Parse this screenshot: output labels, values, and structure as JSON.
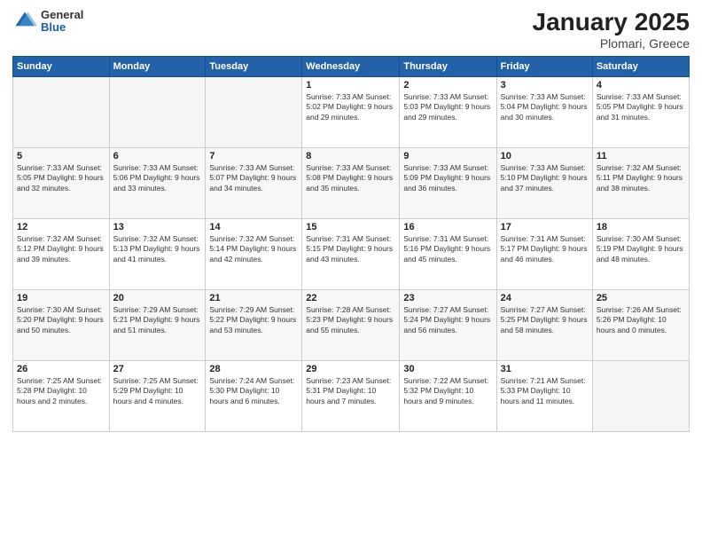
{
  "header": {
    "logo_general": "General",
    "logo_blue": "Blue",
    "title": "January 2025",
    "subtitle": "Plomari, Greece"
  },
  "days_of_week": [
    "Sunday",
    "Monday",
    "Tuesday",
    "Wednesday",
    "Thursday",
    "Friday",
    "Saturday"
  ],
  "weeks": [
    {
      "days": [
        {
          "num": "",
          "info": "",
          "empty": true
        },
        {
          "num": "",
          "info": "",
          "empty": true
        },
        {
          "num": "",
          "info": "",
          "empty": true
        },
        {
          "num": "1",
          "info": "Sunrise: 7:33 AM\nSunset: 5:02 PM\nDaylight: 9 hours\nand 29 minutes.",
          "empty": false
        },
        {
          "num": "2",
          "info": "Sunrise: 7:33 AM\nSunset: 5:03 PM\nDaylight: 9 hours\nand 29 minutes.",
          "empty": false
        },
        {
          "num": "3",
          "info": "Sunrise: 7:33 AM\nSunset: 5:04 PM\nDaylight: 9 hours\nand 30 minutes.",
          "empty": false
        },
        {
          "num": "4",
          "info": "Sunrise: 7:33 AM\nSunset: 5:05 PM\nDaylight: 9 hours\nand 31 minutes.",
          "empty": false
        }
      ]
    },
    {
      "days": [
        {
          "num": "5",
          "info": "Sunrise: 7:33 AM\nSunset: 5:05 PM\nDaylight: 9 hours\nand 32 minutes.",
          "empty": false
        },
        {
          "num": "6",
          "info": "Sunrise: 7:33 AM\nSunset: 5:06 PM\nDaylight: 9 hours\nand 33 minutes.",
          "empty": false
        },
        {
          "num": "7",
          "info": "Sunrise: 7:33 AM\nSunset: 5:07 PM\nDaylight: 9 hours\nand 34 minutes.",
          "empty": false
        },
        {
          "num": "8",
          "info": "Sunrise: 7:33 AM\nSunset: 5:08 PM\nDaylight: 9 hours\nand 35 minutes.",
          "empty": false
        },
        {
          "num": "9",
          "info": "Sunrise: 7:33 AM\nSunset: 5:09 PM\nDaylight: 9 hours\nand 36 minutes.",
          "empty": false
        },
        {
          "num": "10",
          "info": "Sunrise: 7:33 AM\nSunset: 5:10 PM\nDaylight: 9 hours\nand 37 minutes.",
          "empty": false
        },
        {
          "num": "11",
          "info": "Sunrise: 7:32 AM\nSunset: 5:11 PM\nDaylight: 9 hours\nand 38 minutes.",
          "empty": false
        }
      ]
    },
    {
      "days": [
        {
          "num": "12",
          "info": "Sunrise: 7:32 AM\nSunset: 5:12 PM\nDaylight: 9 hours\nand 39 minutes.",
          "empty": false
        },
        {
          "num": "13",
          "info": "Sunrise: 7:32 AM\nSunset: 5:13 PM\nDaylight: 9 hours\nand 41 minutes.",
          "empty": false
        },
        {
          "num": "14",
          "info": "Sunrise: 7:32 AM\nSunset: 5:14 PM\nDaylight: 9 hours\nand 42 minutes.",
          "empty": false
        },
        {
          "num": "15",
          "info": "Sunrise: 7:31 AM\nSunset: 5:15 PM\nDaylight: 9 hours\nand 43 minutes.",
          "empty": false
        },
        {
          "num": "16",
          "info": "Sunrise: 7:31 AM\nSunset: 5:16 PM\nDaylight: 9 hours\nand 45 minutes.",
          "empty": false
        },
        {
          "num": "17",
          "info": "Sunrise: 7:31 AM\nSunset: 5:17 PM\nDaylight: 9 hours\nand 46 minutes.",
          "empty": false
        },
        {
          "num": "18",
          "info": "Sunrise: 7:30 AM\nSunset: 5:19 PM\nDaylight: 9 hours\nand 48 minutes.",
          "empty": false
        }
      ]
    },
    {
      "days": [
        {
          "num": "19",
          "info": "Sunrise: 7:30 AM\nSunset: 5:20 PM\nDaylight: 9 hours\nand 50 minutes.",
          "empty": false
        },
        {
          "num": "20",
          "info": "Sunrise: 7:29 AM\nSunset: 5:21 PM\nDaylight: 9 hours\nand 51 minutes.",
          "empty": false
        },
        {
          "num": "21",
          "info": "Sunrise: 7:29 AM\nSunset: 5:22 PM\nDaylight: 9 hours\nand 53 minutes.",
          "empty": false
        },
        {
          "num": "22",
          "info": "Sunrise: 7:28 AM\nSunset: 5:23 PM\nDaylight: 9 hours\nand 55 minutes.",
          "empty": false
        },
        {
          "num": "23",
          "info": "Sunrise: 7:27 AM\nSunset: 5:24 PM\nDaylight: 9 hours\nand 56 minutes.",
          "empty": false
        },
        {
          "num": "24",
          "info": "Sunrise: 7:27 AM\nSunset: 5:25 PM\nDaylight: 9 hours\nand 58 minutes.",
          "empty": false
        },
        {
          "num": "25",
          "info": "Sunrise: 7:26 AM\nSunset: 5:26 PM\nDaylight: 10 hours\nand 0 minutes.",
          "empty": false
        }
      ]
    },
    {
      "days": [
        {
          "num": "26",
          "info": "Sunrise: 7:25 AM\nSunset: 5:28 PM\nDaylight: 10 hours\nand 2 minutes.",
          "empty": false
        },
        {
          "num": "27",
          "info": "Sunrise: 7:25 AM\nSunset: 5:29 PM\nDaylight: 10 hours\nand 4 minutes.",
          "empty": false
        },
        {
          "num": "28",
          "info": "Sunrise: 7:24 AM\nSunset: 5:30 PM\nDaylight: 10 hours\nand 6 minutes.",
          "empty": false
        },
        {
          "num": "29",
          "info": "Sunrise: 7:23 AM\nSunset: 5:31 PM\nDaylight: 10 hours\nand 7 minutes.",
          "empty": false
        },
        {
          "num": "30",
          "info": "Sunrise: 7:22 AM\nSunset: 5:32 PM\nDaylight: 10 hours\nand 9 minutes.",
          "empty": false
        },
        {
          "num": "31",
          "info": "Sunrise: 7:21 AM\nSunset: 5:33 PM\nDaylight: 10 hours\nand 11 minutes.",
          "empty": false
        },
        {
          "num": "",
          "info": "",
          "empty": true
        }
      ]
    }
  ]
}
